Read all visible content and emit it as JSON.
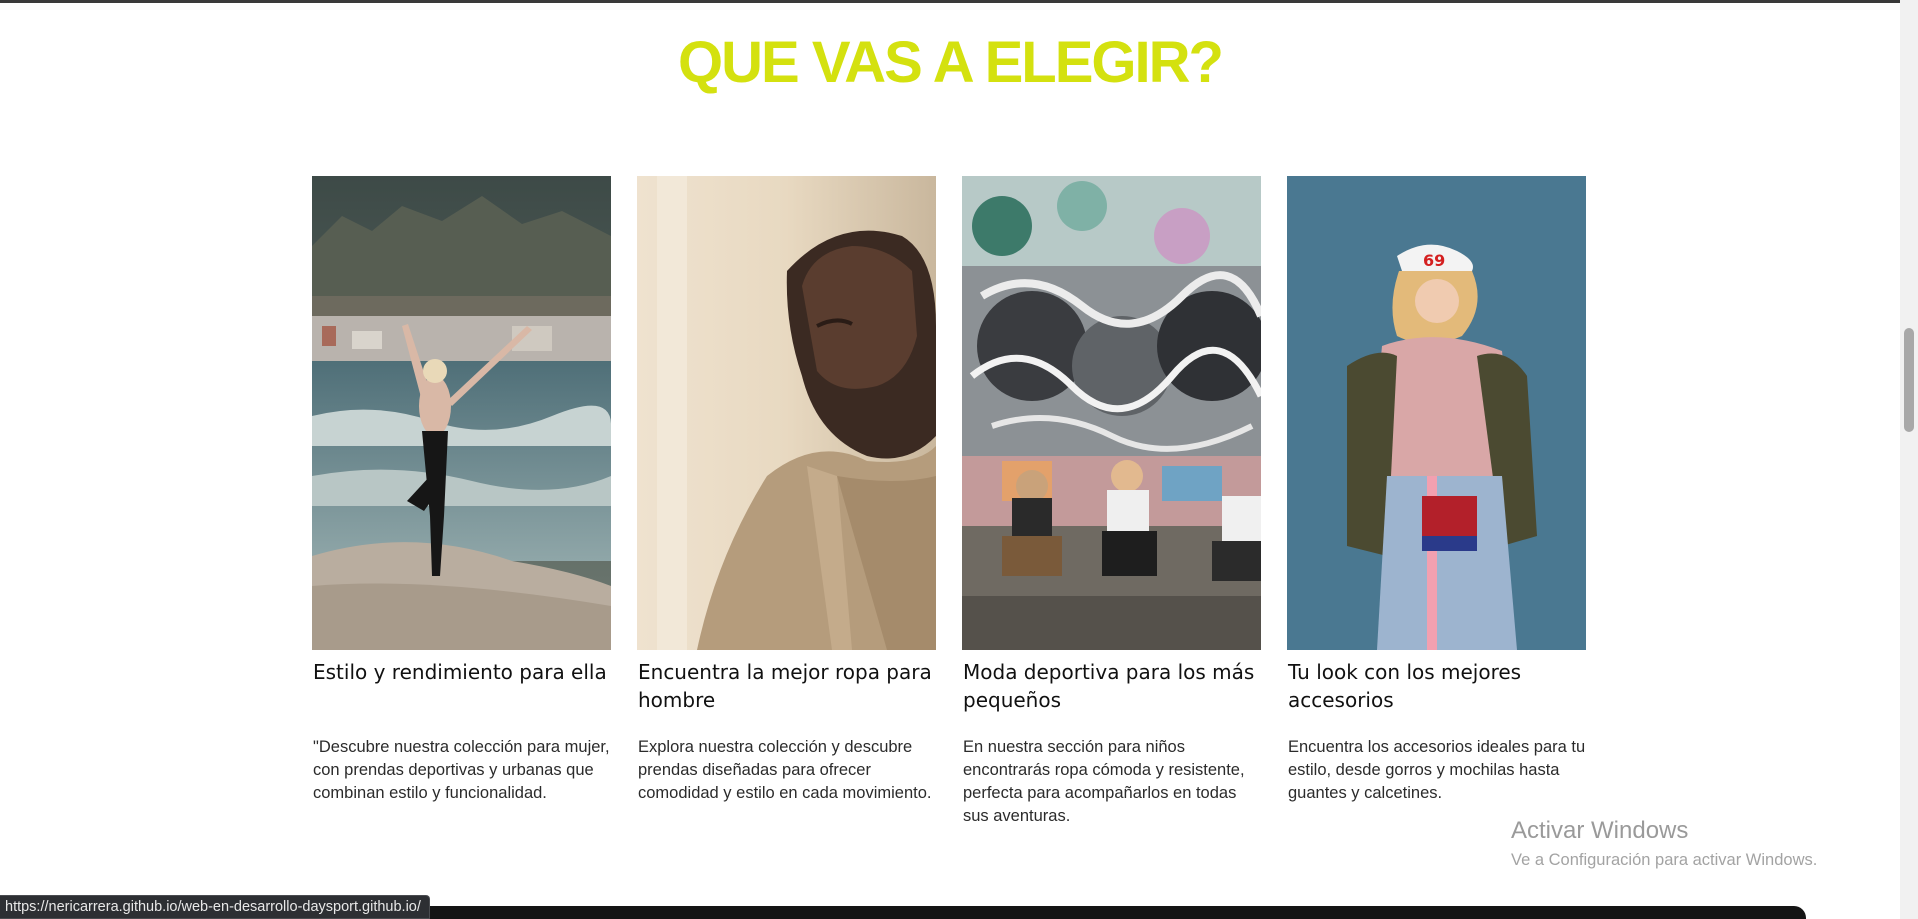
{
  "section": {
    "title": "QUE VAS A ELEGIR?",
    "title_color": "#d4e10f"
  },
  "cards": [
    {
      "title": "Estilo y rendimiento para ella",
      "text": "\"Descubre nuestra colección para mujer, con prendas deportivas y urbanas que combinan estilo y funcionalidad.",
      "image": "woman-yoga-beach-photo"
    },
    {
      "title": "Encuentra la mejor ropa para hombre",
      "text": "Explora nuestra colección y descubre prendas diseñadas para ofrecer comodidad y estilo en cada movimiento.",
      "image": "man-portrait-photo"
    },
    {
      "title": "Moda deportiva para los más pequeños",
      "text": "En nuestra sección para niños encontrarás ropa cómoda y resistente, perfecta para acompañarlos en todas sus aventuras.",
      "image": "kids-graffiti-wall-photo"
    },
    {
      "title": "Tu look con los mejores accesorios",
      "text": "Encuentra los accesorios ideales para tu estilo, desde gorros y mochilas hasta guantes y calcetines.",
      "image": "girl-cap-accessories-photo"
    }
  ],
  "watermark": {
    "title": "Activar Windows",
    "subtitle": "Ve a Configuración para activar Windows."
  },
  "status_bar": {
    "url": "https://nericarrera.github.io/web-en-desarrollo-daysport.github.io/"
  }
}
